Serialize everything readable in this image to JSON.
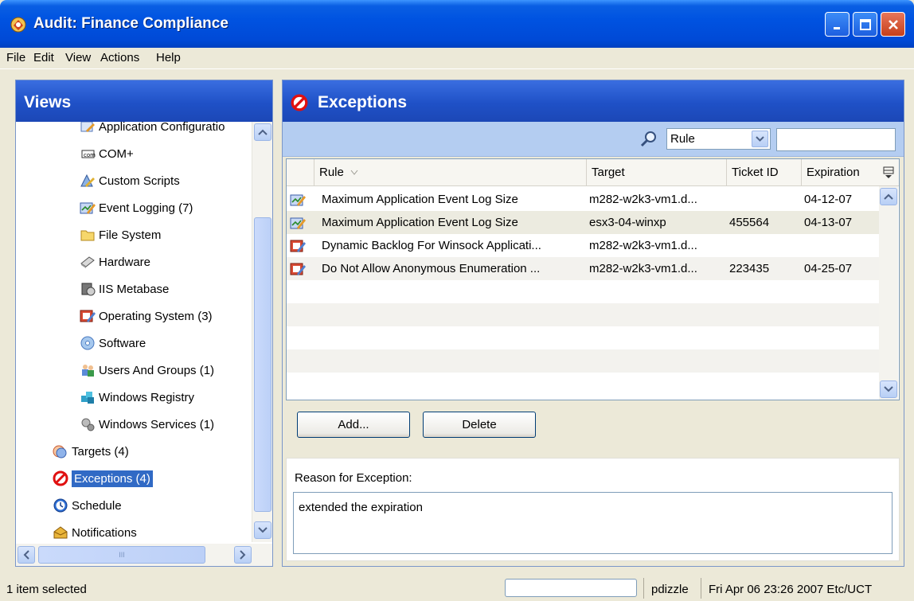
{
  "window": {
    "title": "Audit: Finance Compliance",
    "icon": "audit-app-icon"
  },
  "menu": [
    "File",
    "Edit",
    "View",
    "Actions",
    "Help"
  ],
  "views": {
    "header": "Views",
    "items": [
      {
        "label": "Application Configuratio",
        "icon": "app-config-icon"
      },
      {
        "label": "COM+",
        "icon": "com-plus-icon"
      },
      {
        "label": "Custom Scripts",
        "icon": "custom-scripts-icon"
      },
      {
        "label": "Event Logging (7)",
        "icon": "event-logging-icon"
      },
      {
        "label": "File System",
        "icon": "folder-icon"
      },
      {
        "label": "Hardware",
        "icon": "hardware-icon"
      },
      {
        "label": "IIS Metabase",
        "icon": "iis-metabase-icon"
      },
      {
        "label": "Operating System (3)",
        "icon": "operating-system-icon"
      },
      {
        "label": "Software",
        "icon": "software-icon"
      },
      {
        "label": "Users And Groups (1)",
        "icon": "users-groups-icon"
      },
      {
        "label": "Windows Registry",
        "icon": "registry-icon"
      },
      {
        "label": "Windows Services (1)",
        "icon": "services-icon"
      },
      {
        "label": "Targets (4)",
        "icon": "targets-icon"
      },
      {
        "label": "Exceptions (4)",
        "icon": "exceptions-icon",
        "selected": true
      },
      {
        "label": "Schedule",
        "icon": "schedule-icon"
      },
      {
        "label": "Notifications",
        "icon": "notifications-icon"
      }
    ],
    "hscroll_thumb_text": "III"
  },
  "exceptions": {
    "header": "Exceptions",
    "filter": {
      "field": "Rule",
      "search_value": ""
    },
    "columns": [
      "Rule",
      "Target",
      "Ticket ID",
      "Expiration"
    ],
    "rows": [
      {
        "rule": "Maximum Application Event Log Size",
        "target": "m282-w2k3-vm1.d...",
        "ticket": "",
        "expiration": "04-12-07",
        "icon": "event-logging-icon"
      },
      {
        "rule": "Maximum Application Event Log Size",
        "target": "esx3-04-winxp",
        "ticket": "455564",
        "expiration": "04-13-07",
        "icon": "event-logging-icon",
        "selected": true
      },
      {
        "rule": "Dynamic Backlog For Winsock Applicati...",
        "target": "m282-w2k3-vm1.d...",
        "ticket": "",
        "expiration": "",
        "icon": "operating-system-icon"
      },
      {
        "rule": "Do Not Allow Anonymous Enumeration ...",
        "target": "m282-w2k3-vm1.d...",
        "ticket": "223435",
        "expiration": "04-25-07",
        "icon": "operating-system-icon"
      }
    ],
    "add_label": "Add...",
    "delete_label": "Delete",
    "reason_label": "Reason for Exception:",
    "reason_text": "extended the expiration"
  },
  "status": {
    "left": "1 item selected",
    "user": "pdizzle",
    "datetime": "Fri Apr 06 23:26 2007 Etc/UCT"
  },
  "colors": {
    "title_blue": "#0053e1",
    "selection": "#316ac5",
    "pane_header": "#1f51c7",
    "filterbar": "#b4cdf1"
  }
}
